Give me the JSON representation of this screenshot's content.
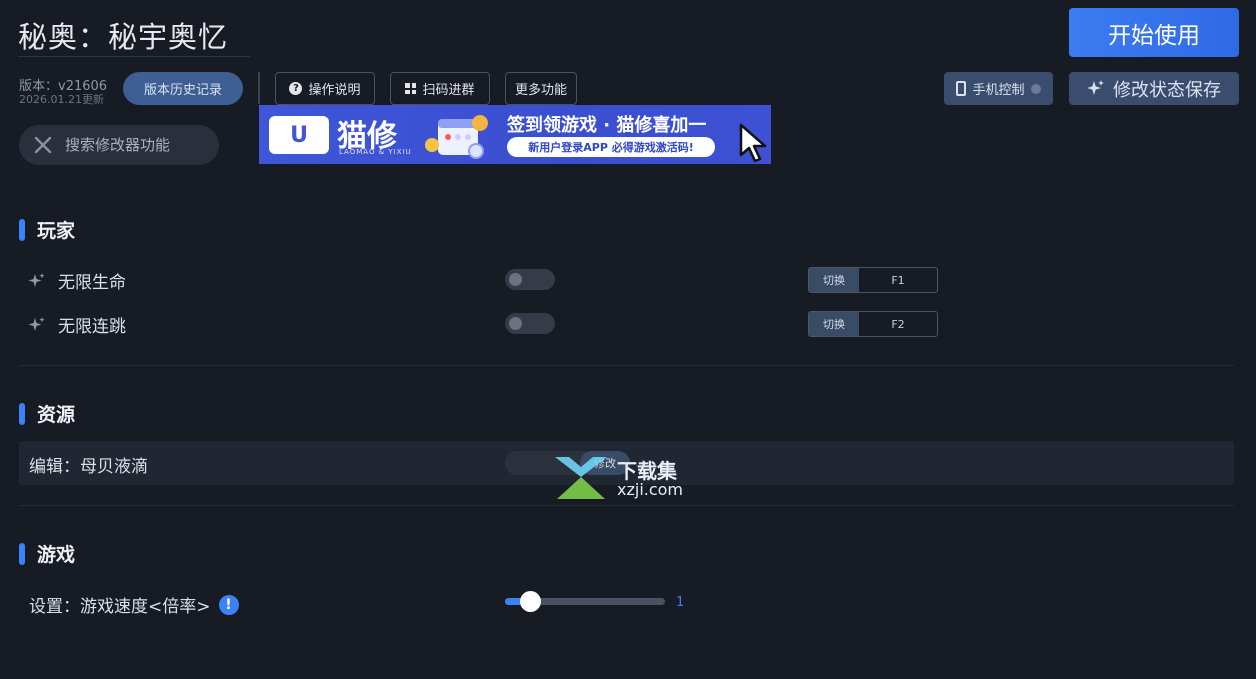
{
  "header": {
    "title": "秘奥：秘宇奥忆",
    "start_label": "开始使用",
    "version": "版本：v21606",
    "version_date": "2026.01.21更新",
    "history_label": "版本历史记录"
  },
  "toolbar": {
    "help_label": "操作说明",
    "qr_label": "扫码进群",
    "more_label": "更多功能",
    "phone_label": "手机控制",
    "save_label": "修改状态保存"
  },
  "search": {
    "placeholder": "搜索修改器功能"
  },
  "banner": {
    "brand": "猫修",
    "brand_sub": "LAOMAO & YIXIU",
    "headline": "签到领游戏 · 猫修喜加一",
    "pill": "新用户登录APP 必得游戏激活码!"
  },
  "sections": {
    "player": {
      "title": "玩家",
      "rows": [
        {
          "label": "无限生命",
          "toggle_on": false,
          "hotkey_label": "切换",
          "hotkey": "F1"
        },
        {
          "label": "无限连跳",
          "toggle_on": false,
          "hotkey_label": "切换",
          "hotkey": "F2"
        }
      ]
    },
    "resources": {
      "title": "资源",
      "row_label": "编辑：母贝液滴",
      "input_value": "",
      "button_label": "修改"
    },
    "game": {
      "title": "游戏",
      "speed_label": "设置：游戏速度<倍率>",
      "info_glyph": "!",
      "speed_value": "1",
      "speed_fraction": 0.05
    }
  },
  "watermark": {
    "text": "下载集",
    "sub": "xzji.com"
  },
  "colors": {
    "accent": "#3b82f6",
    "background": "#161b24"
  }
}
